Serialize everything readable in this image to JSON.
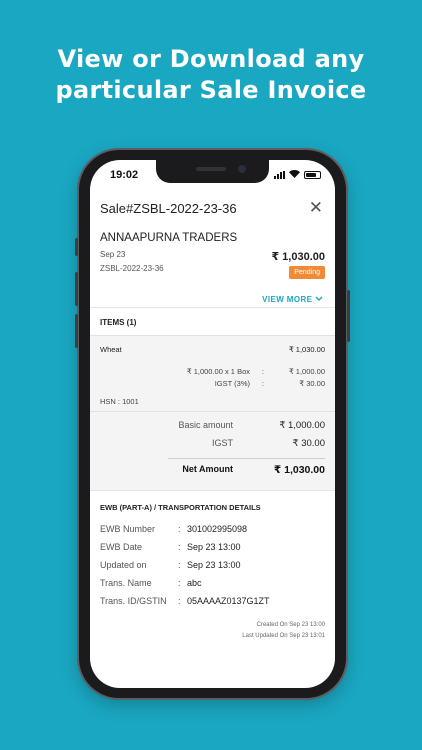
{
  "headline": {
    "line1": "View or Download any",
    "line2": "particular Sale Invoice"
  },
  "status_bar": {
    "time": "19:02"
  },
  "invoice": {
    "title": "Sale#ZSBL-2022-23-36",
    "party_name": "ANNAAPURNA TRADERS",
    "date": "Sep 23",
    "doc_number": "ZSBL-2022-23-36",
    "total_amount": "₹ 1,030.00",
    "status": "Pending",
    "status_color": "#f08a36",
    "view_more_label": "VIEW MORE",
    "items_header": "ITEMS (1)",
    "item": {
      "name": "Wheat",
      "amount": "₹ 1,030.00",
      "qty_line": "₹ 1,000.00 x 1 Box",
      "qty_colon": ":",
      "qty_value": "₹ 1,000.00",
      "tax_label": "IGST (3%)",
      "tax_colon": ":",
      "tax_value": "₹ 30.00",
      "hsn": "HSN : 1001"
    },
    "totals": {
      "basic_label": "Basic amount",
      "basic_value": "₹ 1,000.00",
      "igst_label": "IGST",
      "igst_value": "₹ 30.00",
      "net_label": "Net Amount",
      "net_value": "₹ 1,030.00"
    },
    "ewb": {
      "title": "EWB (PART-A) / TRANSPORTATION DETAILS",
      "rows": [
        {
          "key": "EWB Number",
          "value": "301002995098"
        },
        {
          "key": "EWB Date",
          "value": "Sep 23 13:00"
        },
        {
          "key": "Updated on",
          "value": "Sep 23 13:00"
        },
        {
          "key": "Trans. Name",
          "value": "abc"
        },
        {
          "key": "Trans. ID/GSTIN",
          "value": "05AAAAZ0137G1ZT"
        }
      ],
      "separator": ":"
    },
    "footer": {
      "created": "Created On Sep 23 13:00",
      "updated": "Last Updated On Sep 23 13:01"
    }
  },
  "colors": {
    "background": "#1aa7c2",
    "accent": "#1aa7c2"
  },
  "icons": {
    "close": "close-icon",
    "chevron": "chevron-down-icon",
    "signal": "signal-icon",
    "wifi": "wifi-icon",
    "battery": "battery-icon"
  }
}
